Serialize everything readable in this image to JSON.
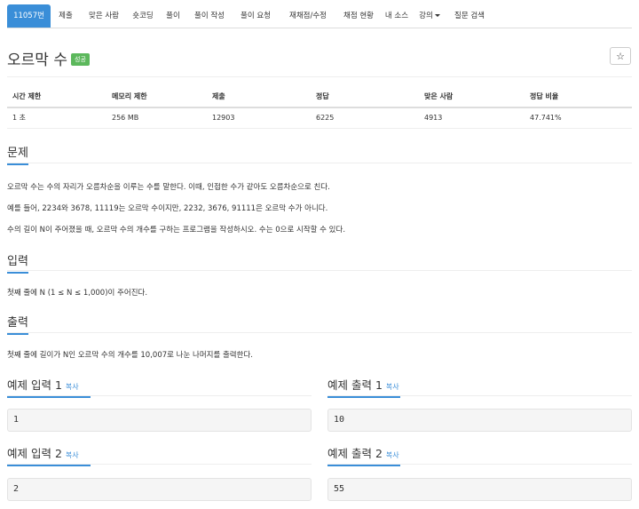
{
  "tabs": [
    {
      "label": "11057번",
      "active": true
    },
    {
      "label": "제출"
    },
    {
      "label": "맞은 사람"
    },
    {
      "label": "숏코딩"
    },
    {
      "label": "풀이"
    },
    {
      "label": "풀이 작성"
    },
    {
      "label": "풀이 요청"
    },
    {
      "label": "재채점/수정"
    },
    {
      "label": "채점 현황"
    },
    {
      "label": "내 소스"
    },
    {
      "label": "강의"
    },
    {
      "label": "질문 검색"
    }
  ],
  "problem": {
    "title": "오르막 수",
    "badge": "성공",
    "star": "☆"
  },
  "stats": {
    "headers": [
      "시간 제한",
      "메모리 제한",
      "제출",
      "정답",
      "맞은 사람",
      "정답 비율"
    ],
    "values": [
      "1 초",
      "256 MB",
      "12903",
      "6225",
      "4913",
      "47.741%"
    ]
  },
  "sections": {
    "desc": {
      "title": "문제",
      "lines": [
        "오르막 수는 수의 자리가 오름차순을 이루는 수를 말한다. 이때, 인접한 수가 같아도 오름차순으로 친다.",
        "예를 들어, 2234와 3678, 11119는 오르막 수이지만, 2232, 3676, 91111은 오르막 수가 아니다.",
        "수의 길이 N이 주어졌을 때, 오르막 수의 개수를 구하는 프로그램을 작성하시오. 수는 0으로 시작할 수 있다."
      ]
    },
    "input": {
      "title": "입력",
      "line": "첫째 줄에 N (1 ≤ N ≤ 1,000)이 주어진다."
    },
    "output": {
      "title": "출력",
      "line": "첫째 줄에 길이가 N인 오르막 수의 개수를 10,007로 나눈 나머지를 출력한다."
    }
  },
  "examples": {
    "copy_label": "복사",
    "in1_title": "예제 입력 1",
    "out1_title": "예제 출력 1",
    "in1": "1",
    "out1": "10",
    "in2_title": "예제 입력 2",
    "out2_title": "예제 출력 2",
    "in2": "2",
    "out2": "55"
  }
}
